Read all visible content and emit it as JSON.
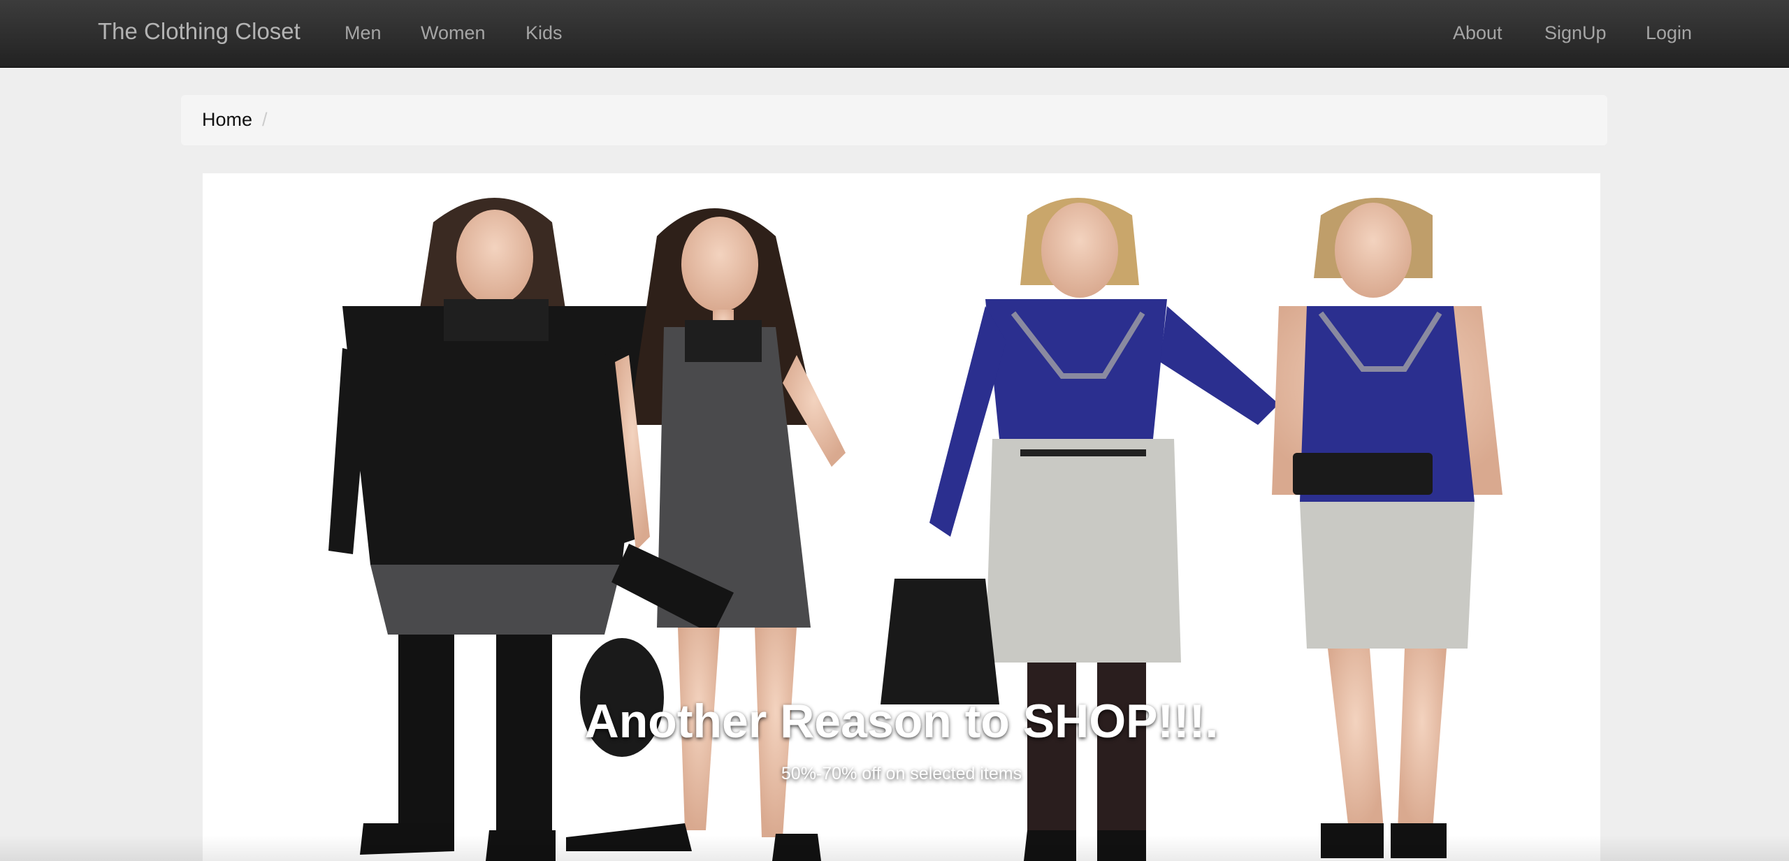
{
  "navbar": {
    "brand": "The Clothing Closet",
    "left_links": [
      "Men",
      "Women",
      "Kids"
    ],
    "right_links": [
      "About",
      "SignUp",
      "Login"
    ]
  },
  "breadcrumb": {
    "home": "Home",
    "separator": "/"
  },
  "carousel": {
    "caption_title": "Another Reason to SHOP!!!.",
    "caption_text": "50%-70% off on selected items",
    "prev_icon": "chevron-left-icon",
    "next_icon": "chevron-right-icon"
  },
  "colors": {
    "navbar_bg": "#222222",
    "page_bg": "#eeeeee",
    "breadcrumb_bg": "#f5f5f5",
    "dress_black": "#1b1b1b",
    "dress_gray": "#4a4a4c",
    "top_blue": "#2b2f8f",
    "skirt_gray": "#c9c9c4"
  }
}
